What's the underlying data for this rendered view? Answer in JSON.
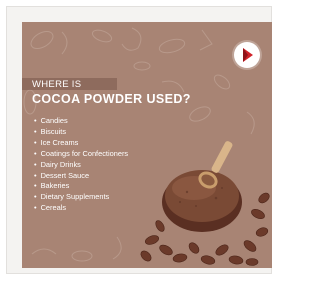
{
  "poster": {
    "title_line1": "WHERE IS",
    "title_line2": "COCOA POWDER USED?",
    "uses": [
      "Candies",
      "Biscuits",
      "Ice Creams",
      "Coatings for Confectioners",
      "Dairy Drinks",
      "Dessert Sauce",
      "Bakeries",
      "Dietary Supplements",
      "Cereals"
    ],
    "colors": {
      "background": "#a88474",
      "text": "#ffffff",
      "logo_red": "#d0232a",
      "cocoa_bean": "#6b3a2a",
      "powder": "#7a4a35"
    },
    "icons": [
      "brand-logo-icon",
      "cocoa-bean-icon",
      "wooden-scoop-icon",
      "bowl-icon"
    ]
  }
}
